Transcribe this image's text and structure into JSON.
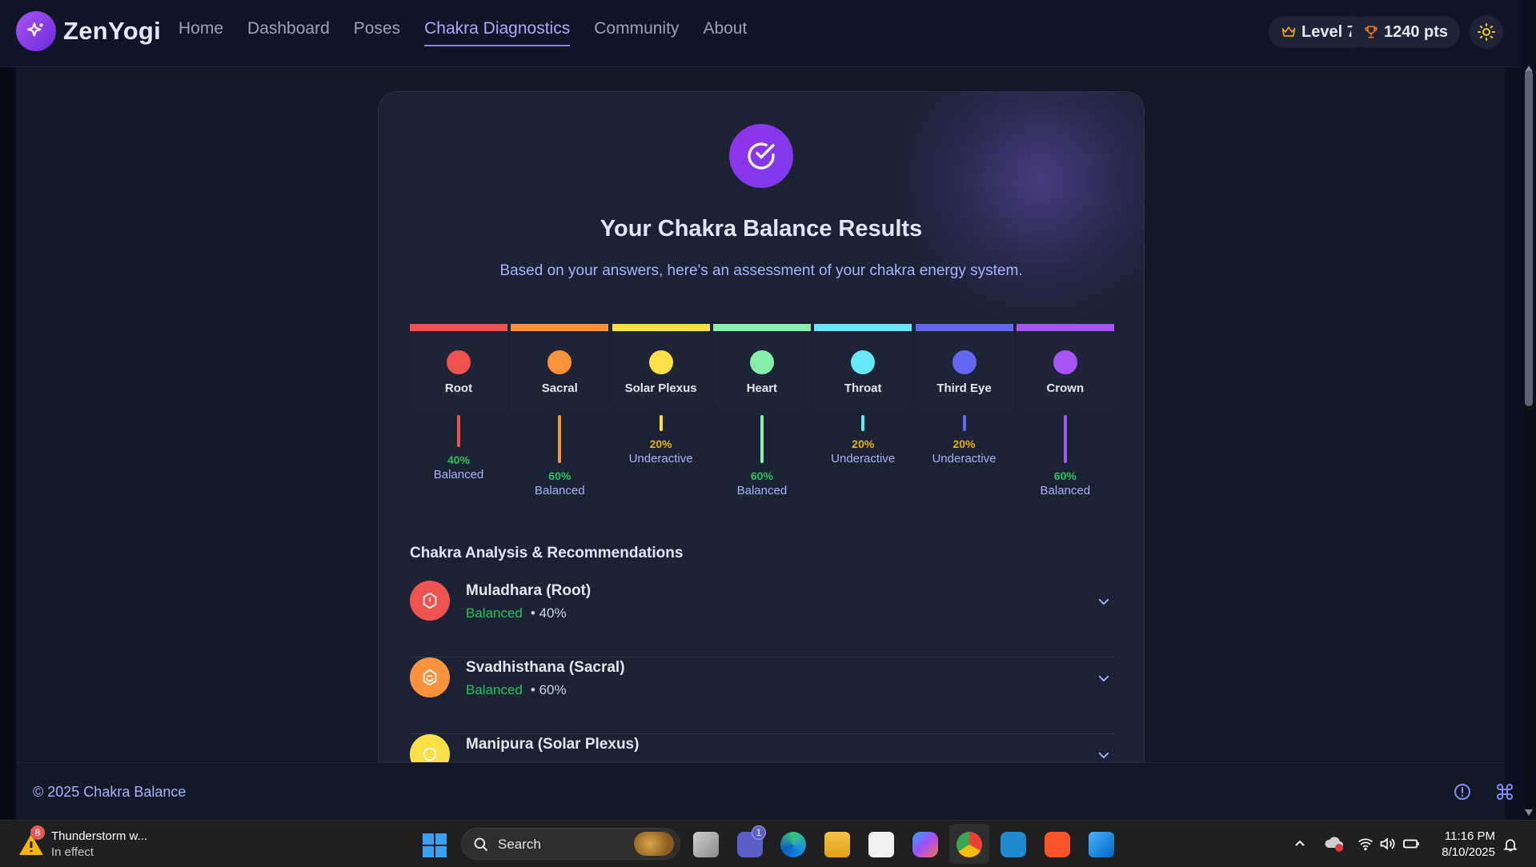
{
  "app": {
    "brand": "ZenYogi"
  },
  "nav": {
    "items": [
      "Home",
      "Dashboard",
      "Poses",
      "Chakra Diagnostics",
      "Community",
      "About"
    ],
    "active": "Chakra Diagnostics"
  },
  "header": {
    "level": "Level 7",
    "points": "1240 pts"
  },
  "results": {
    "title": "Your Chakra Balance Results",
    "subtitle": "Based on your answers, here's an assessment of your chakra energy system."
  },
  "chakras": [
    {
      "name": "Root",
      "color": "#ef5350",
      "percent": 40,
      "percent_label": "40%",
      "status": "Balanced",
      "status_color": "#22c55e"
    },
    {
      "name": "Sacral",
      "color": "#fb923c",
      "percent": 60,
      "percent_label": "60%",
      "status": "Balanced",
      "status_color": "#22c55e"
    },
    {
      "name": "Solar Plexus",
      "color": "#fde047",
      "percent": 20,
      "percent_label": "20%",
      "status": "Underactive",
      "status_color": "#eab308"
    },
    {
      "name": "Heart",
      "color": "#86efac",
      "percent": 60,
      "percent_label": "60%",
      "status": "Balanced",
      "status_color": "#22c55e"
    },
    {
      "name": "Throat",
      "color": "#67e8f9",
      "percent": 20,
      "percent_label": "20%",
      "status": "Underactive",
      "status_color": "#eab308"
    },
    {
      "name": "Third Eye",
      "color": "#6366f1",
      "percent": 20,
      "percent_label": "20%",
      "status": "Underactive",
      "status_color": "#eab308"
    },
    {
      "name": "Crown",
      "color": "#a855f7",
      "percent": 60,
      "percent_label": "60%",
      "status": "Balanced",
      "status_color": "#22c55e"
    }
  ],
  "analysis": {
    "heading": "Chakra Analysis & Recommendations",
    "items": [
      {
        "name": "Muladhara (Root)",
        "status": "Balanced",
        "percent": "• 40%",
        "color": "#ef5350"
      },
      {
        "name": "Svadhisthana (Sacral)",
        "status": "Balanced",
        "percent": "• 60%",
        "color": "#fb923c"
      },
      {
        "name": "Manipura (Solar Plexus)",
        "status": "",
        "percent": "",
        "color": "#fde047"
      }
    ]
  },
  "footer": {
    "copyright": "© 2025 Chakra Balance"
  },
  "taskbar": {
    "weather_title": "Thunderstorm w...",
    "weather_sub": "In effect",
    "weather_badge": "8",
    "search": "Search",
    "teams_badge": "1",
    "time": "11:16 PM",
    "date": "8/10/2025"
  }
}
